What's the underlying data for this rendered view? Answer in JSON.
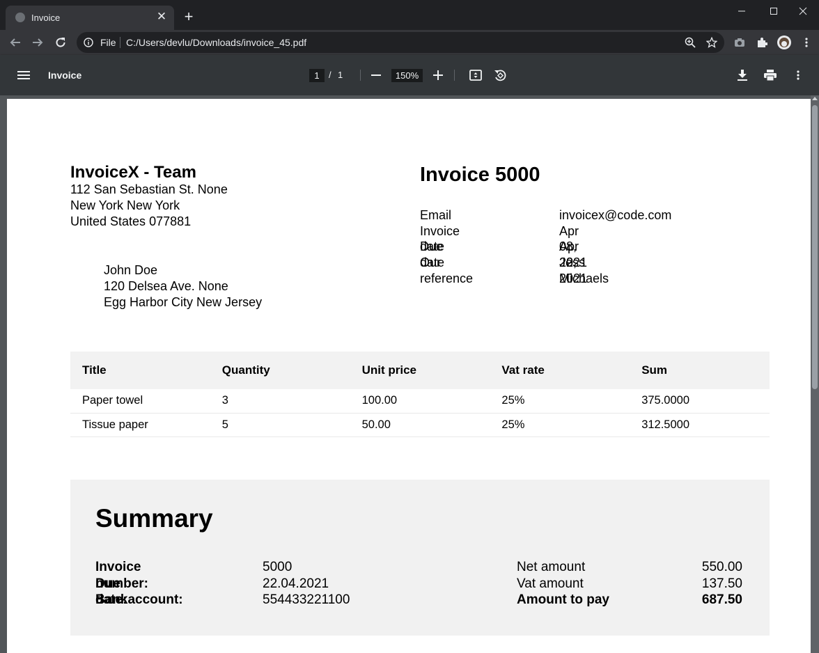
{
  "browser": {
    "tab_title": "Invoice",
    "omnibox": {
      "scheme": "File",
      "url": "C:/Users/devlu/Downloads/invoice_45.pdf"
    }
  },
  "pdf_toolbar": {
    "title": "Invoice",
    "current_page": "1",
    "page_separator": "/",
    "total_pages": "1",
    "zoom": "150%"
  },
  "invoice": {
    "sender": {
      "name": "InvoiceX - Team",
      "address_line1": "112 San Sebastian St. None",
      "address_line2": "New York New York",
      "address_line3": "United States 077881"
    },
    "recipient": {
      "name": "John Doe",
      "address_line1": "120 Delsea Ave. None",
      "address_line2": "Egg Harbor City New Jersey"
    },
    "title": "Invoice 5000",
    "meta": [
      {
        "label": "Email",
        "value": "invoicex@code.com"
      },
      {
        "label": "Invoice date",
        "value": "Apr 08, 2021"
      },
      {
        "label": "Due date",
        "value": "Apr 22, 2021"
      },
      {
        "label": "Our reference",
        "value": "Jess Michaels"
      }
    ],
    "table": {
      "headers": [
        "Title",
        "Quantity",
        "Unit price",
        "Vat rate",
        "Sum"
      ],
      "rows": [
        [
          "Paper towel",
          "3",
          "100.00",
          "25%",
          "375.0000"
        ],
        [
          "Tissue paper",
          "5",
          "50.00",
          "25%",
          "312.5000"
        ]
      ]
    },
    "summary": {
      "title": "Summary",
      "left": [
        {
          "label": "Invoice number:",
          "value": "5000"
        },
        {
          "label": "Due date:",
          "value": "22.04.2021"
        },
        {
          "label": "Bankaccount:",
          "value": "554433221100"
        }
      ],
      "right": [
        {
          "label": "Net amount",
          "value": "550.00"
        },
        {
          "label": "Vat amount",
          "value": "137.50"
        },
        {
          "label": "Amount to pay",
          "value": "687.50"
        }
      ]
    }
  }
}
